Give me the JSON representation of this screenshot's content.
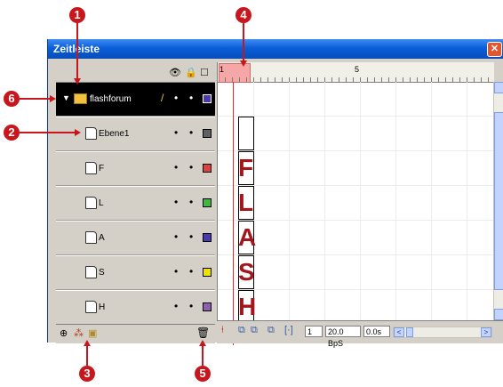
{
  "window": {
    "title": "Zeitleiste",
    "close_glyph": "✕"
  },
  "layer_header": {
    "eye": "👁",
    "lock": "🔒",
    "outline": "□"
  },
  "layers": [
    {
      "name": "flashforum",
      "type": "folder",
      "selected": true,
      "color": "#4a3ab0"
    },
    {
      "name": "Ebene1",
      "type": "layer",
      "selected": false,
      "color": "#606060"
    },
    {
      "name": "F",
      "type": "layer",
      "selected": false,
      "color": "#e04040"
    },
    {
      "name": "L",
      "type": "layer",
      "selected": false,
      "color": "#40b840"
    },
    {
      "name": "A",
      "type": "layer",
      "selected": false,
      "color": "#4a3ab0"
    },
    {
      "name": "S",
      "type": "layer",
      "selected": false,
      "color": "#f0e000"
    },
    {
      "name": "H",
      "type": "layer",
      "selected": false,
      "color": "#9060b0"
    }
  ],
  "timeline": {
    "ruler_labels": [
      "1",
      "5"
    ],
    "letters": [
      "F",
      "L",
      "A",
      "S",
      "H"
    ]
  },
  "status": {
    "frame": "1",
    "fps": "20.0 BpS",
    "time": "0.0s"
  },
  "callouts": [
    "1",
    "2",
    "3",
    "4",
    "5",
    "6"
  ],
  "colors": {
    "accent": "#c8161d",
    "selected_row": "#000000",
    "letter": "#a3161b"
  }
}
